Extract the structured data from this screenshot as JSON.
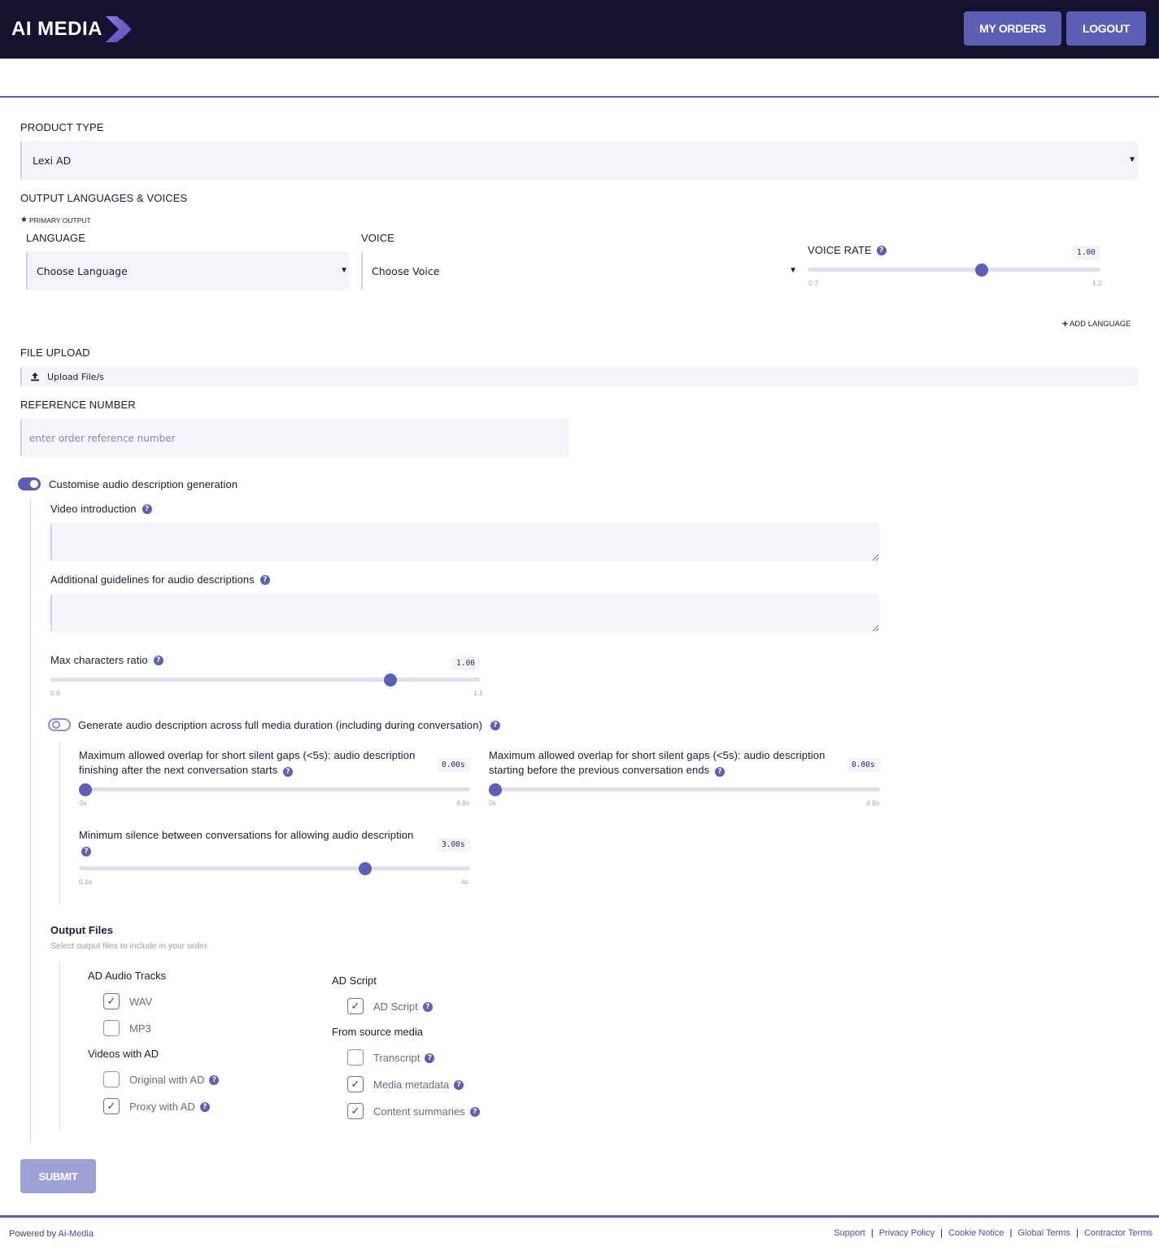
{
  "header": {
    "logo_text": "AI MEDIA",
    "my_orders_label": "MY ORDERS",
    "logout_label": "LOGOUT"
  },
  "product_type": {
    "label": "PRODUCT TYPE",
    "value": "Lexi AD"
  },
  "output_languages": {
    "label": "OUTPUT LANGUAGES & VOICES",
    "primary_output_label": "PRIMARY OUTPUT",
    "language_label": "LANGUAGE",
    "language_placeholder": "Choose Language",
    "voice_label": "VOICE",
    "voice_placeholder": "Choose Voice",
    "voice_rate": {
      "label": "VOICE RATE",
      "value": "1.00",
      "min": "0.7",
      "max": "1.2",
      "level": 0.6
    },
    "add_language_label": "ADD LANGUAGE"
  },
  "file_upload": {
    "label": "FILE UPLOAD",
    "button_label": "Upload File/s"
  },
  "reference_number": {
    "label": "REFERENCE NUMBER",
    "placeholder": "enter order reference number"
  },
  "customise": {
    "toggle_label": "Customise audio description generation",
    "toggle_on": true,
    "video_intro_label": "Video introduction",
    "guidelines_label": "Additional guidelines for audio descriptions",
    "max_chars": {
      "label": "Max characters ratio",
      "value": "1.00",
      "min": "0.6",
      "max": "1.1",
      "level": 0.8
    },
    "full_duration": {
      "toggle_label": "Generate audio description across full media duration (including during conversation)",
      "toggle_on": false
    },
    "overlap_after": {
      "label": "Maximum allowed overlap for short silent gaps (<5s): audio description finishing after the next conversation starts",
      "value": "0.00s",
      "min": "0s",
      "max": "4.9s",
      "level": 0.0
    },
    "overlap_before": {
      "label": "Maximum allowed overlap for short silent gaps (<5s): audio description starting before the previous conversation ends",
      "value": "0.00s",
      "min": "0s",
      "max": "4.9s",
      "level": 0.0
    },
    "min_silence": {
      "label": "Minimum silence between conversations for allowing audio description",
      "value": "3.00s",
      "min": "0.1s",
      "max": "4s",
      "level": 0.74
    }
  },
  "output_files": {
    "title": "Output Files",
    "subtitle": "Select output files to include in your order.",
    "ad_audio_tracks": "AD Audio Tracks",
    "wav": "WAV",
    "mp3": "MP3",
    "videos_with_ad": "Videos with AD",
    "original_with_ad": "Original with AD",
    "proxy_with_ad": "Proxy with AD",
    "ad_script_heading": "AD Script",
    "ad_script": "AD Script",
    "from_source_media": "From source media",
    "transcript": "Transcript",
    "media_metadata": "Media metadata",
    "content_summaries": "Content summaries"
  },
  "submit_label": "SUBMIT",
  "footer": {
    "powered_by": "Powered by",
    "brand_link": "Ai-Media",
    "links": [
      "Support",
      "Privacy Policy",
      "Cookie Notice",
      "Global Terms",
      "Contractor Terms"
    ]
  },
  "colors": {
    "header_bg": "#14122f",
    "accent": "#5b5fb5",
    "submit_disabled": "#9ea1d6"
  }
}
